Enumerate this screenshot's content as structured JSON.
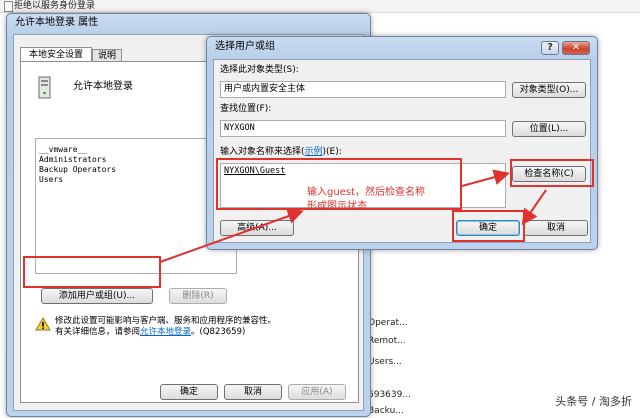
{
  "background": {
    "title": "拒绝以服务身份登录",
    "list_fragments": [
      "Operat...",
      "Remot...",
      "Users...",
      "Backu..."
    ],
    "list_number": "693639..."
  },
  "properties_dialog": {
    "title": "允许本地登录 属性",
    "tabs": [
      {
        "label": "本地安全设置"
      },
      {
        "label": "说明"
      }
    ],
    "policy_name": "允许本地登录",
    "members": [
      "__vmware__",
      "Administrators",
      "Backup Operators",
      "Users"
    ],
    "add_button": "添加用户或组(U)...",
    "remove_button": "删除(R)",
    "warning_line1": "修改此设置可能影响与客户端、服务和应用程序的兼容性。",
    "warning_line2_prefix": "有关详细信息，请参阅",
    "warning_link": "允许本地登录",
    "warning_line2_suffix": "。(Q823659)",
    "ok_button": "确定",
    "cancel_button": "取消",
    "apply_button": "应用(A)"
  },
  "select_dialog": {
    "title": "选择用户或组",
    "help_glyph": "?",
    "close_glyph": "✕",
    "object_type_label": "选择此对象类型(S):",
    "object_type_value": "用户或内置安全主体",
    "object_types_button": "对象类型(O)...",
    "location_label": "查找位置(F):",
    "location_value": "NYXGON",
    "locations_button": "位置(L)...",
    "names_label_prefix": "输入对象名称来选择(",
    "names_label_link": "示例",
    "names_label_suffix": ")(E):",
    "names_value": "NYXGON\\Guest",
    "check_names_button": "检查名称(C)",
    "advanced_button": "高级(A)...",
    "ok_button": "确定",
    "cancel_button": "取消"
  },
  "annotation": {
    "line1": "输入guest，然后检查名称",
    "line2": "形成图示状态"
  },
  "watermark": {
    "text": "头条号 / 淘多折"
  },
  "colors": {
    "annotation_red": "#e0322f",
    "link_blue": "#0066cc"
  }
}
